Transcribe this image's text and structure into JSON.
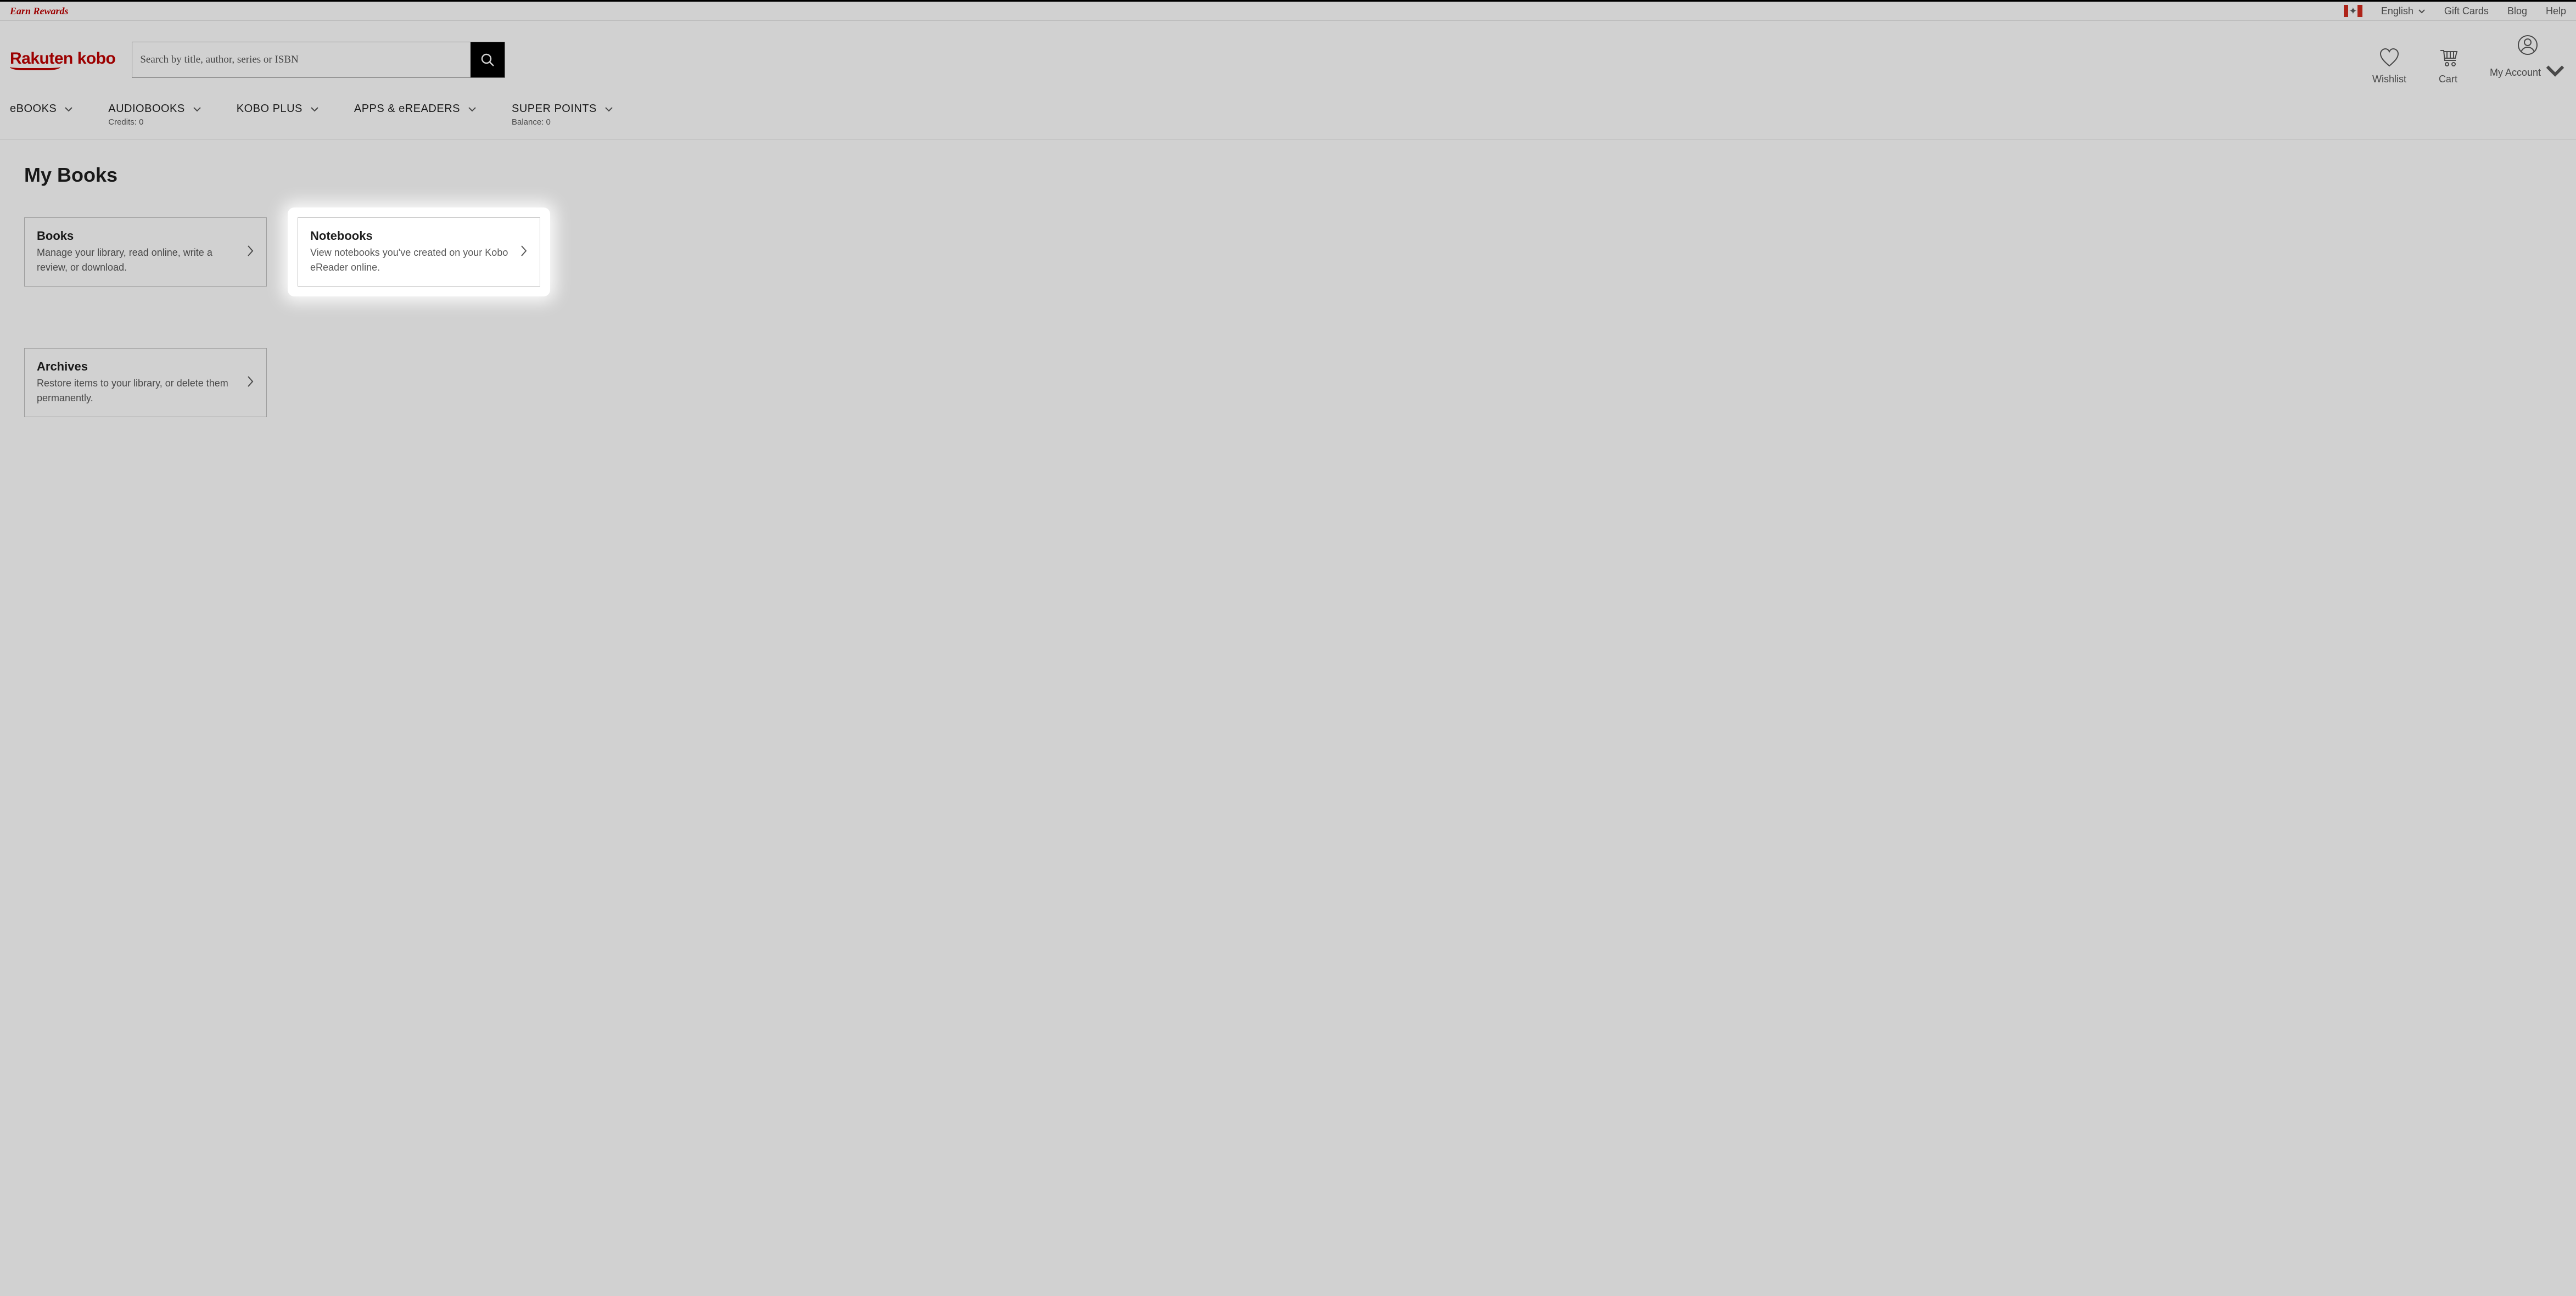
{
  "promo": {
    "earn_rewards": "Earn Rewards",
    "language": "English",
    "gift_cards": "Gift Cards",
    "blog": "Blog",
    "help": "Help"
  },
  "header": {
    "logo": "Rakuten kobo",
    "search_placeholder": "Search by title, author, series or ISBN",
    "wishlist": "Wishlist",
    "cart": "Cart",
    "account": "My Account"
  },
  "nav": {
    "ebooks": "eBOOKS",
    "audiobooks": "AUDIOBOOKS",
    "audiobooks_sub": "Credits: 0",
    "kobo_plus": "KOBO PLUS",
    "apps": "APPS & eREADERS",
    "super_points": "SUPER POINTS",
    "super_points_sub": "Balance: 0"
  },
  "page": {
    "title": "My Books",
    "cards": {
      "books": {
        "title": "Books",
        "desc": "Manage your library, read online, write a review, or download."
      },
      "notebooks": {
        "title": "Notebooks",
        "desc": "View notebooks you've created on your Kobo eReader online."
      },
      "archives": {
        "title": "Archives",
        "desc": "Restore items to your library, or delete them permanently."
      }
    }
  }
}
